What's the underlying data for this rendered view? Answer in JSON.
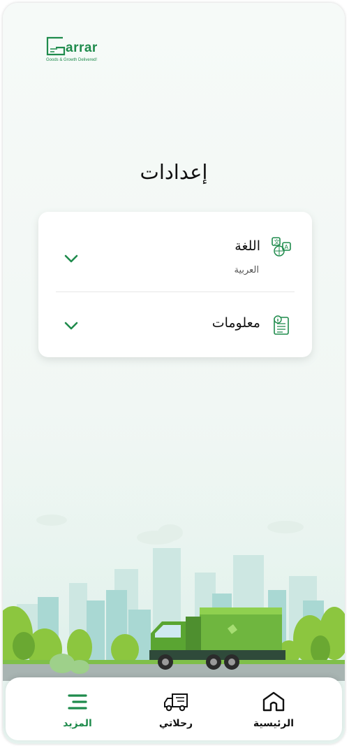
{
  "logo": {
    "word": "arrar",
    "tagline": "Goods & Growth Delivered!",
    "brand_color": "#1f8b4c"
  },
  "page": {
    "title": "إعدادات"
  },
  "settings": {
    "language": {
      "label": "اللغة",
      "value": "العربية",
      "icon": "language-translate-icon"
    },
    "info": {
      "label": "معلومات",
      "icon": "info-document-icon"
    }
  },
  "nav": {
    "more": {
      "label": "المزيد",
      "icon": "menu-icon",
      "active": true
    },
    "trips": {
      "label": "رحلاتي",
      "icon": "truck-icon"
    },
    "home": {
      "label": "الرئيسية",
      "icon": "home-icon"
    }
  },
  "colors": {
    "accent": "#1f8b4c",
    "text": "#111111"
  }
}
